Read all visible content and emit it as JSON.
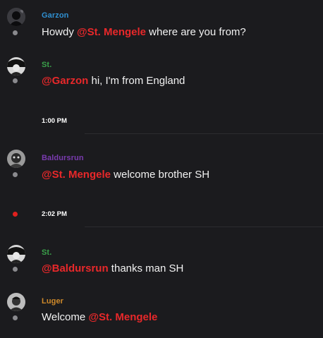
{
  "messages": [
    {
      "author": "Garzon",
      "author_color": "#2f8fd0",
      "parts": [
        "Howdy ",
        "@St. Mengele",
        " where are you from?"
      ]
    },
    {
      "author": "St.",
      "author_color": "#3aa04a",
      "parts": [
        "@Garzon",
        " hi, I'm from England"
      ]
    },
    {
      "author": "Baldursrun",
      "author_color": "#7a3bb0",
      "parts": [
        "@St. Mengele",
        " welcome brother SH"
      ]
    },
    {
      "author": "St.",
      "author_color": "#3aa04a",
      "parts": [
        "@Baldursrun",
        " thanks man SH"
      ]
    },
    {
      "author": "Luger",
      "author_color": "#d08a2a",
      "parts": [
        "Welcome ",
        "@St. Mengele"
      ]
    }
  ],
  "timestamps": [
    "1:00 PM",
    "2:02 PM"
  ],
  "colors": {
    "background": "#1b1b1e",
    "mention": "#e8282a",
    "unread_dot": "#e0201e",
    "dot": "#8a8a8e"
  }
}
